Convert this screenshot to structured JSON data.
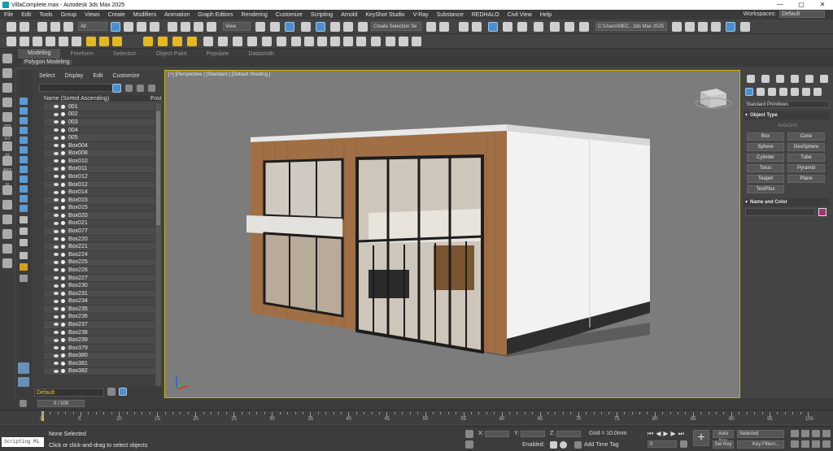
{
  "window": {
    "title": "VillaComplete.max - Autodesk 3ds Max 2025",
    "controls": [
      "—",
      "▢",
      "✕"
    ]
  },
  "menu": {
    "items": [
      "File",
      "Edit",
      "Tools",
      "Group",
      "Views",
      "Create",
      "Modifiers",
      "Animation",
      "Graph Editors",
      "Rendering",
      "Customize",
      "Scripting",
      "Arnold",
      "KeyShot Studio",
      "V-Ray",
      "Substance",
      "REDHALO",
      "Civil View",
      "Help"
    ],
    "workspaces_label": "Workspaces:",
    "workspaces_value": "Default"
  },
  "toolbar": {
    "filter_value": "All",
    "view_value": "View",
    "selection_set_value": "Create Selection Se",
    "path_value": "C:\\Users\\MEC...3ds Max 2025"
  },
  "ribbon": {
    "tabs": [
      "Modeling",
      "Freeform",
      "Selection",
      "Object Paint",
      "Populate",
      "Datasmith"
    ],
    "subtab": "Polygon Modeling"
  },
  "lefttools": {
    "labels": [
      "proj",
      "ect",
      "obj",
      "alem",
      "ss"
    ]
  },
  "explorer": {
    "menu": [
      "Select",
      "Display",
      "Edit",
      "Customize"
    ],
    "column_name": "Name (Sorted Ascending)",
    "column_frozen": "Froz",
    "rows": [
      "001",
      "002",
      "003",
      "004",
      "005",
      "Box004",
      "Box008",
      "Box010",
      "Box011",
      "Box012",
      "Box012",
      "Box014",
      "Box015",
      "Box015",
      "Box020",
      "Box021",
      "Box077",
      "Box220",
      "Box221",
      "Box224",
      "Box225",
      "Box226",
      "Box227",
      "Box230",
      "Box231",
      "Box234",
      "Box235",
      "Box236",
      "Box237",
      "Box238",
      "Box239",
      "Box379",
      "Box380",
      "Box381",
      "Box382"
    ],
    "layer_value": "Default"
  },
  "viewport": {
    "label": "[+] [Perspective ] [Standard ] [Default Shading ]"
  },
  "command_panel": {
    "dropdown": "Standard Primitives",
    "object_type_label": "Object Type",
    "autogrid_label": "AutoGrid",
    "buttons": [
      "Box",
      "Cone",
      "Sphere",
      "GeoSphere",
      "Cylinder",
      "Tube",
      "Torus",
      "Pyramid",
      "Teapot",
      "Plane",
      "TextPlus"
    ],
    "name_color_label": "Name and Color",
    "object_color": "#a8307a"
  },
  "timeline": {
    "slider_label": "0 / 100",
    "tick_labels": [
      "0",
      "5",
      "10",
      "15",
      "20",
      "25",
      "30",
      "35",
      "40",
      "45",
      "50",
      "55",
      "60",
      "65",
      "70",
      "75",
      "80",
      "85",
      "90",
      "95",
      "100"
    ]
  },
  "status": {
    "maxscript_label": "Scripting Mi",
    "selection_status": "None Selected",
    "prompt": "Click or click-and-drag to select objects",
    "x_label": "X:",
    "y_label": "Y:",
    "z_label": "Z:",
    "grid": "Grid = 10.0mm",
    "enabled_label": "Enabled:",
    "add_time_tag": "Add Time Tag",
    "auto_key": "Auto Key",
    "set_key": "Set Key",
    "selected_value": "Selected",
    "key_filters": "Key Filters...",
    "frame_value": "0"
  }
}
